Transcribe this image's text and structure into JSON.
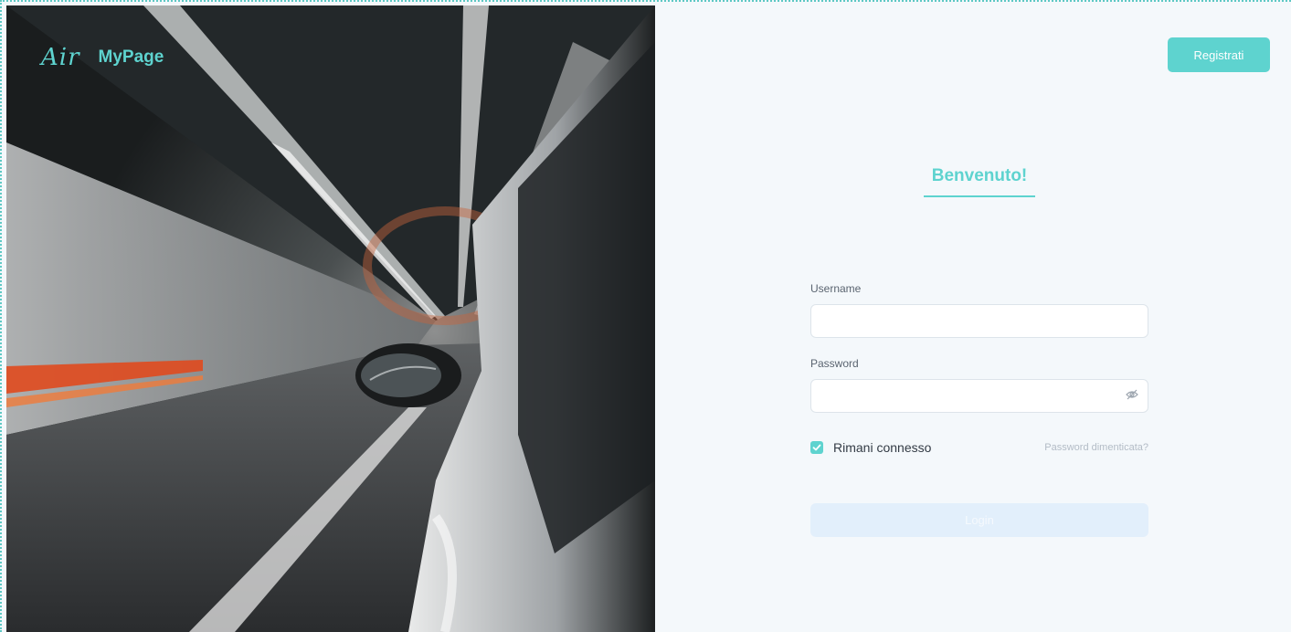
{
  "brand": {
    "script_logo": "Air",
    "name": "MyPage"
  },
  "hero": {
    "image": "car-in-tunnel-photo"
  },
  "header": {
    "register_label": "Registrati"
  },
  "login": {
    "title": "Benvenuto!",
    "username_label": "Username",
    "username_value": "",
    "password_label": "Password",
    "password_value": "",
    "remember_label": "Rimani connesso",
    "remember_checked": true,
    "forgot_label": "Password dimenticata?",
    "submit_label": "Login"
  },
  "icons": {
    "password_toggle": "eye-off-icon",
    "checkbox": "check-icon"
  },
  "colors": {
    "accent": "#5ed3cf",
    "panel_bg": "#f4f8fb",
    "login_disabled_bg": "#e2effb",
    "muted_text": "#b3bcc6"
  }
}
